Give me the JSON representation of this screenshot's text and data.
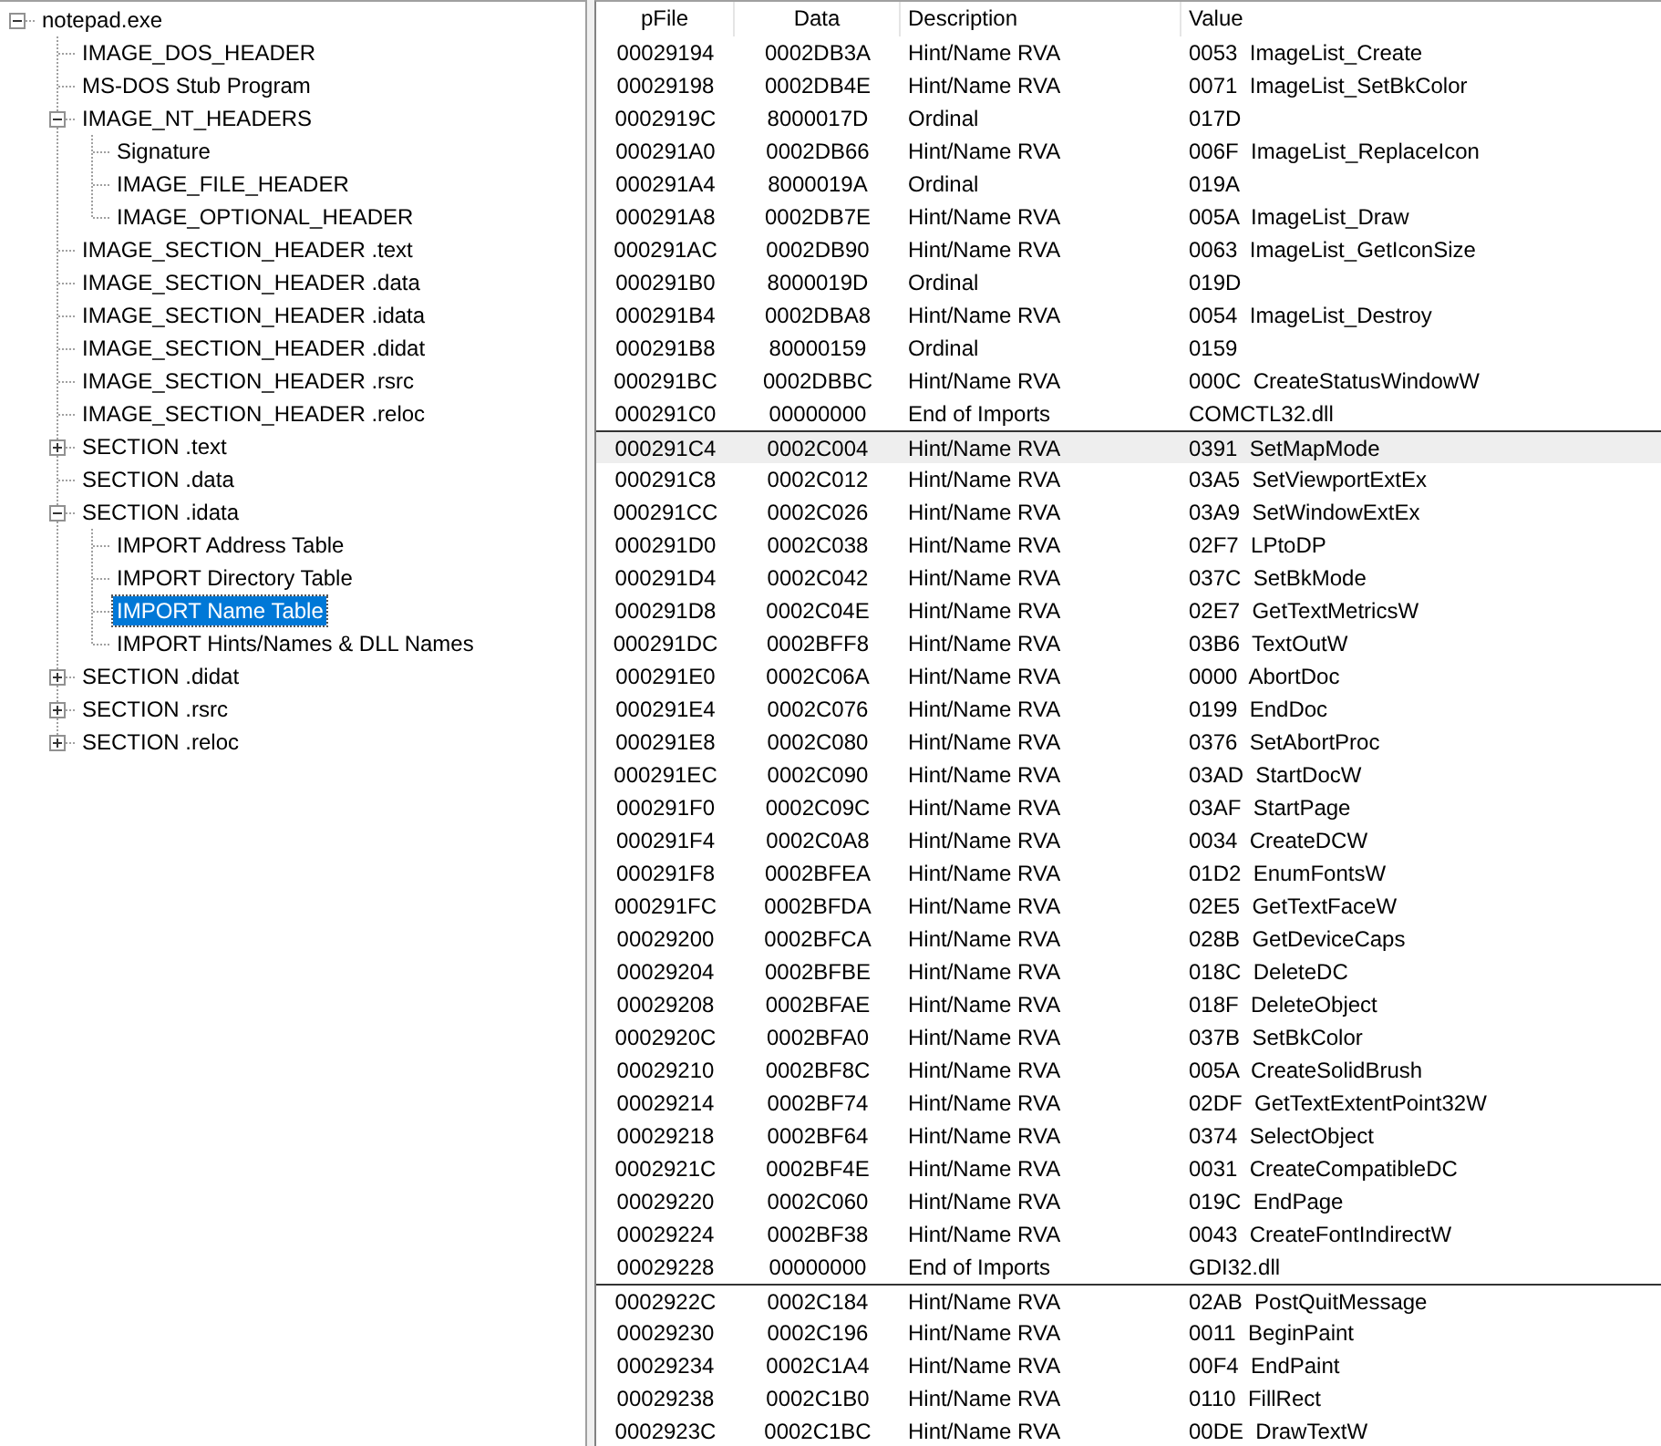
{
  "tree": {
    "items": [
      {
        "label": "notepad.exe",
        "selected": false,
        "expanded": true,
        "children": [
          {
            "label": "IMAGE_DOS_HEADER",
            "selected": false
          },
          {
            "label": "MS-DOS Stub Program",
            "selected": false
          },
          {
            "label": "IMAGE_NT_HEADERS",
            "selected": false,
            "expanded": true,
            "children": [
              {
                "label": "Signature",
                "selected": false
              },
              {
                "label": "IMAGE_FILE_HEADER",
                "selected": false
              },
              {
                "label": "IMAGE_OPTIONAL_HEADER",
                "selected": false
              }
            ]
          },
          {
            "label": "IMAGE_SECTION_HEADER .text",
            "selected": false
          },
          {
            "label": "IMAGE_SECTION_HEADER .data",
            "selected": false
          },
          {
            "label": "IMAGE_SECTION_HEADER .idata",
            "selected": false
          },
          {
            "label": "IMAGE_SECTION_HEADER .didat",
            "selected": false
          },
          {
            "label": "IMAGE_SECTION_HEADER .rsrc",
            "selected": false
          },
          {
            "label": "IMAGE_SECTION_HEADER .reloc",
            "selected": false
          },
          {
            "label": "SECTION .text",
            "selected": false,
            "expanded": false
          },
          {
            "label": "SECTION .data",
            "selected": false
          },
          {
            "label": "SECTION .idata",
            "selected": false,
            "expanded": true,
            "children": [
              {
                "label": "IMPORT Address Table",
                "selected": false
              },
              {
                "label": "IMPORT Directory Table",
                "selected": false
              },
              {
                "label": "IMPORT Name Table",
                "selected": true
              },
              {
                "label": "IMPORT Hints/Names & DLL Names",
                "selected": false
              }
            ]
          },
          {
            "label": "SECTION .didat",
            "selected": false,
            "expanded": false
          },
          {
            "label": "SECTION .rsrc",
            "selected": false,
            "expanded": false
          },
          {
            "label": "SECTION .reloc",
            "selected": false,
            "expanded": false
          }
        ]
      }
    ]
  },
  "table": {
    "columns": [
      "pFile",
      "Data",
      "Description",
      "Value"
    ],
    "groups": [
      {
        "rows": [
          {
            "pfile": "00029194",
            "data": "0002DB3A",
            "description": "Hint/Name RVA",
            "value": "0053  ImageList_Create",
            "selected": false
          },
          {
            "pfile": "00029198",
            "data": "0002DB4E",
            "description": "Hint/Name RVA",
            "value": "0071  ImageList_SetBkColor",
            "selected": false
          },
          {
            "pfile": "0002919C",
            "data": "8000017D",
            "description": "Ordinal",
            "value": "017D",
            "selected": false
          },
          {
            "pfile": "000291A0",
            "data": "0002DB66",
            "description": "Hint/Name RVA",
            "value": "006F  ImageList_ReplaceIcon",
            "selected": false
          },
          {
            "pfile": "000291A4",
            "data": "8000019A",
            "description": "Ordinal",
            "value": "019A",
            "selected": false
          },
          {
            "pfile": "000291A8",
            "data": "0002DB7E",
            "description": "Hint/Name RVA",
            "value": "005A  ImageList_Draw",
            "selected": false
          },
          {
            "pfile": "000291AC",
            "data": "0002DB90",
            "description": "Hint/Name RVA",
            "value": "0063  ImageList_GetIconSize",
            "selected": false
          },
          {
            "pfile": "000291B0",
            "data": "8000019D",
            "description": "Ordinal",
            "value": "019D",
            "selected": false
          },
          {
            "pfile": "000291B4",
            "data": "0002DBA8",
            "description": "Hint/Name RVA",
            "value": "0054  ImageList_Destroy",
            "selected": false
          },
          {
            "pfile": "000291B8",
            "data": "80000159",
            "description": "Ordinal",
            "value": "0159",
            "selected": false
          },
          {
            "pfile": "000291BC",
            "data": "0002DBBC",
            "description": "Hint/Name RVA",
            "value": "000C  CreateStatusWindowW",
            "selected": false
          },
          {
            "pfile": "000291C0",
            "data": "00000000",
            "description": "End of Imports",
            "value": "COMCTL32.dll",
            "selected": false
          }
        ]
      },
      {
        "rows": [
          {
            "pfile": "000291C4",
            "data": "0002C004",
            "description": "Hint/Name RVA",
            "value": "0391  SetMapMode",
            "selected": true
          },
          {
            "pfile": "000291C8",
            "data": "0002C012",
            "description": "Hint/Name RVA",
            "value": "03A5  SetViewportExtEx",
            "selected": false
          },
          {
            "pfile": "000291CC",
            "data": "0002C026",
            "description": "Hint/Name RVA",
            "value": "03A9  SetWindowExtEx",
            "selected": false
          },
          {
            "pfile": "000291D0",
            "data": "0002C038",
            "description": "Hint/Name RVA",
            "value": "02F7  LPtoDP",
            "selected": false
          },
          {
            "pfile": "000291D4",
            "data": "0002C042",
            "description": "Hint/Name RVA",
            "value": "037C  SetBkMode",
            "selected": false
          },
          {
            "pfile": "000291D8",
            "data": "0002C04E",
            "description": "Hint/Name RVA",
            "value": "02E7  GetTextMetricsW",
            "selected": false
          },
          {
            "pfile": "000291DC",
            "data": "0002BFF8",
            "description": "Hint/Name RVA",
            "value": "03B6  TextOutW",
            "selected": false
          },
          {
            "pfile": "000291E0",
            "data": "0002C06A",
            "description": "Hint/Name RVA",
            "value": "0000  AbortDoc",
            "selected": false
          },
          {
            "pfile": "000291E4",
            "data": "0002C076",
            "description": "Hint/Name RVA",
            "value": "0199  EndDoc",
            "selected": false
          },
          {
            "pfile": "000291E8",
            "data": "0002C080",
            "description": "Hint/Name RVA",
            "value": "0376  SetAbortProc",
            "selected": false
          },
          {
            "pfile": "000291EC",
            "data": "0002C090",
            "description": "Hint/Name RVA",
            "value": "03AD  StartDocW",
            "selected": false
          },
          {
            "pfile": "000291F0",
            "data": "0002C09C",
            "description": "Hint/Name RVA",
            "value": "03AF  StartPage",
            "selected": false
          },
          {
            "pfile": "000291F4",
            "data": "0002C0A8",
            "description": "Hint/Name RVA",
            "value": "0034  CreateDCW",
            "selected": false
          },
          {
            "pfile": "000291F8",
            "data": "0002BFEA",
            "description": "Hint/Name RVA",
            "value": "01D2  EnumFontsW",
            "selected": false
          },
          {
            "pfile": "000291FC",
            "data": "0002BFDA",
            "description": "Hint/Name RVA",
            "value": "02E5  GetTextFaceW",
            "selected": false
          },
          {
            "pfile": "00029200",
            "data": "0002BFCA",
            "description": "Hint/Name RVA",
            "value": "028B  GetDeviceCaps",
            "selected": false
          },
          {
            "pfile": "00029204",
            "data": "0002BFBE",
            "description": "Hint/Name RVA",
            "value": "018C  DeleteDC",
            "selected": false
          },
          {
            "pfile": "00029208",
            "data": "0002BFAE",
            "description": "Hint/Name RVA",
            "value": "018F  DeleteObject",
            "selected": false
          },
          {
            "pfile": "0002920C",
            "data": "0002BFA0",
            "description": "Hint/Name RVA",
            "value": "037B  SetBkColor",
            "selected": false
          },
          {
            "pfile": "00029210",
            "data": "0002BF8C",
            "description": "Hint/Name RVA",
            "value": "005A  CreateSolidBrush",
            "selected": false
          },
          {
            "pfile": "00029214",
            "data": "0002BF74",
            "description": "Hint/Name RVA",
            "value": "02DF  GetTextExtentPoint32W",
            "selected": false
          },
          {
            "pfile": "00029218",
            "data": "0002BF64",
            "description": "Hint/Name RVA",
            "value": "0374  SelectObject",
            "selected": false
          },
          {
            "pfile": "0002921C",
            "data": "0002BF4E",
            "description": "Hint/Name RVA",
            "value": "0031  CreateCompatibleDC",
            "selected": false
          },
          {
            "pfile": "00029220",
            "data": "0002C060",
            "description": "Hint/Name RVA",
            "value": "019C  EndPage",
            "selected": false
          },
          {
            "pfile": "00029224",
            "data": "0002BF38",
            "description": "Hint/Name RVA",
            "value": "0043  CreateFontIndirectW",
            "selected": false
          },
          {
            "pfile": "00029228",
            "data": "00000000",
            "description": "End of Imports",
            "value": "GDI32.dll",
            "selected": false
          }
        ]
      },
      {
        "rows": [
          {
            "pfile": "0002922C",
            "data": "0002C184",
            "description": "Hint/Name RVA",
            "value": "02AB  PostQuitMessage",
            "selected": false
          },
          {
            "pfile": "00029230",
            "data": "0002C196",
            "description": "Hint/Name RVA",
            "value": "0011  BeginPaint",
            "selected": false
          },
          {
            "pfile": "00029234",
            "data": "0002C1A4",
            "description": "Hint/Name RVA",
            "value": "00F4  EndPaint",
            "selected": false
          },
          {
            "pfile": "00029238",
            "data": "0002C1B0",
            "description": "Hint/Name RVA",
            "value": "0110  FillRect",
            "selected": false
          },
          {
            "pfile": "0002923C",
            "data": "0002C1BC",
            "description": "Hint/Name RVA",
            "value": "00DE  DrawTextW",
            "selected": false
          }
        ]
      }
    ]
  }
}
